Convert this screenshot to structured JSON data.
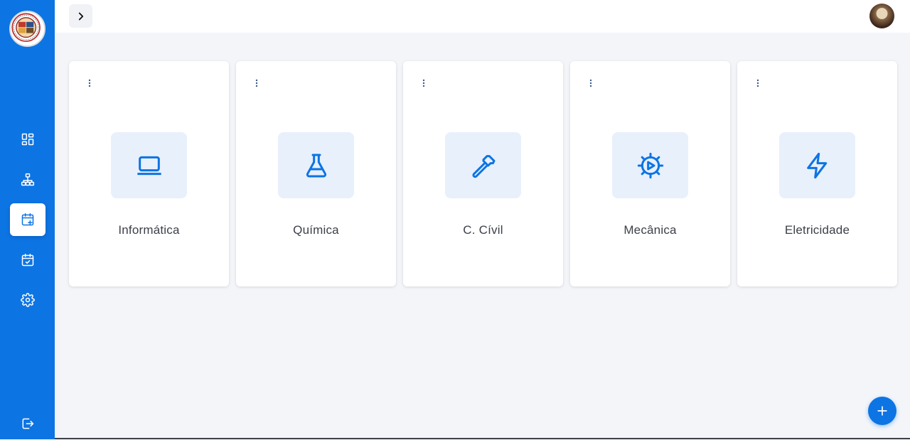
{
  "theme": {
    "accent": "#0d74e3",
    "icon_bg": "#e8f0fc",
    "page_bg": "#f3f5f9"
  },
  "sidebar": {
    "logo": "institution-seal",
    "items": [
      {
        "icon": "dashboard-icon",
        "active": false
      },
      {
        "icon": "sitemap-icon",
        "active": false
      },
      {
        "icon": "calendar-plus-icon",
        "active": true
      },
      {
        "icon": "calendar-check-icon",
        "active": false
      },
      {
        "icon": "gear-icon",
        "active": false
      }
    ],
    "logout_icon": "logout-icon"
  },
  "topbar": {
    "toggle_icon": "chevron-right-icon",
    "avatar": "user-avatar"
  },
  "cards": [
    {
      "label": "Informática",
      "icon": "laptop-icon"
    },
    {
      "label": "Química",
      "icon": "flask-icon"
    },
    {
      "label": "C. Cívil",
      "icon": "hammer-icon"
    },
    {
      "label": "Mecânica",
      "icon": "gear-play-icon"
    },
    {
      "label": "Eletricidade",
      "icon": "lightning-icon"
    }
  ],
  "fab": {
    "icon": "plus-icon"
  }
}
